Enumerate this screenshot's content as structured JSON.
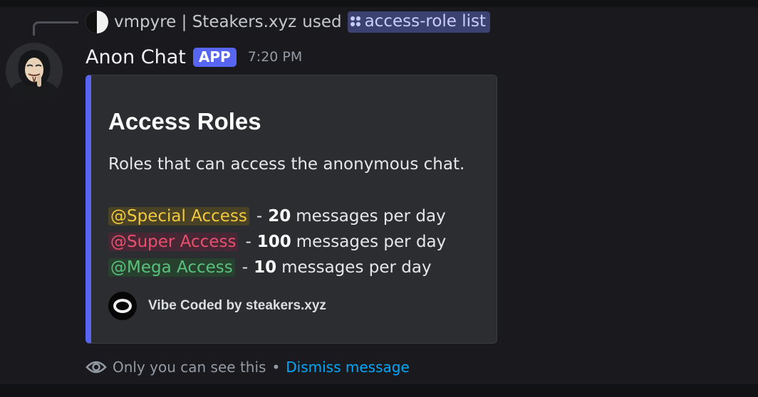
{
  "reply": {
    "user": "vmpyre | Steakers.xyz",
    "used_text": "used",
    "command": "access-role list"
  },
  "message": {
    "author": "Anon Chat",
    "badge": "APP",
    "timestamp": "7:20 PM"
  },
  "embed": {
    "accent_color": "#5865f2",
    "title": "Access Roles",
    "description": "Roles that can access the anonymous chat.",
    "roles": [
      {
        "mention": "@Special Access",
        "separator": "-",
        "count": "20",
        "suffix": "messages per day",
        "color": "#f0c93e"
      },
      {
        "mention": "@Super Access",
        "separator": "-",
        "count": "100",
        "suffix": "messages per day",
        "color": "#e7506f"
      },
      {
        "mention": "@Mega Access",
        "separator": "-",
        "count": "10",
        "suffix": "messages per day",
        "color": "#5bc07b"
      }
    ],
    "footer_text": "Vibe Coded by steakers.xyz"
  },
  "ephemeral": {
    "notice": "Only you can see this",
    "separator": "•",
    "dismiss_label": "Dismiss message"
  },
  "icons": {
    "command": "command-icon",
    "eye": "eye-icon",
    "footer": "steakers-logo-icon"
  }
}
